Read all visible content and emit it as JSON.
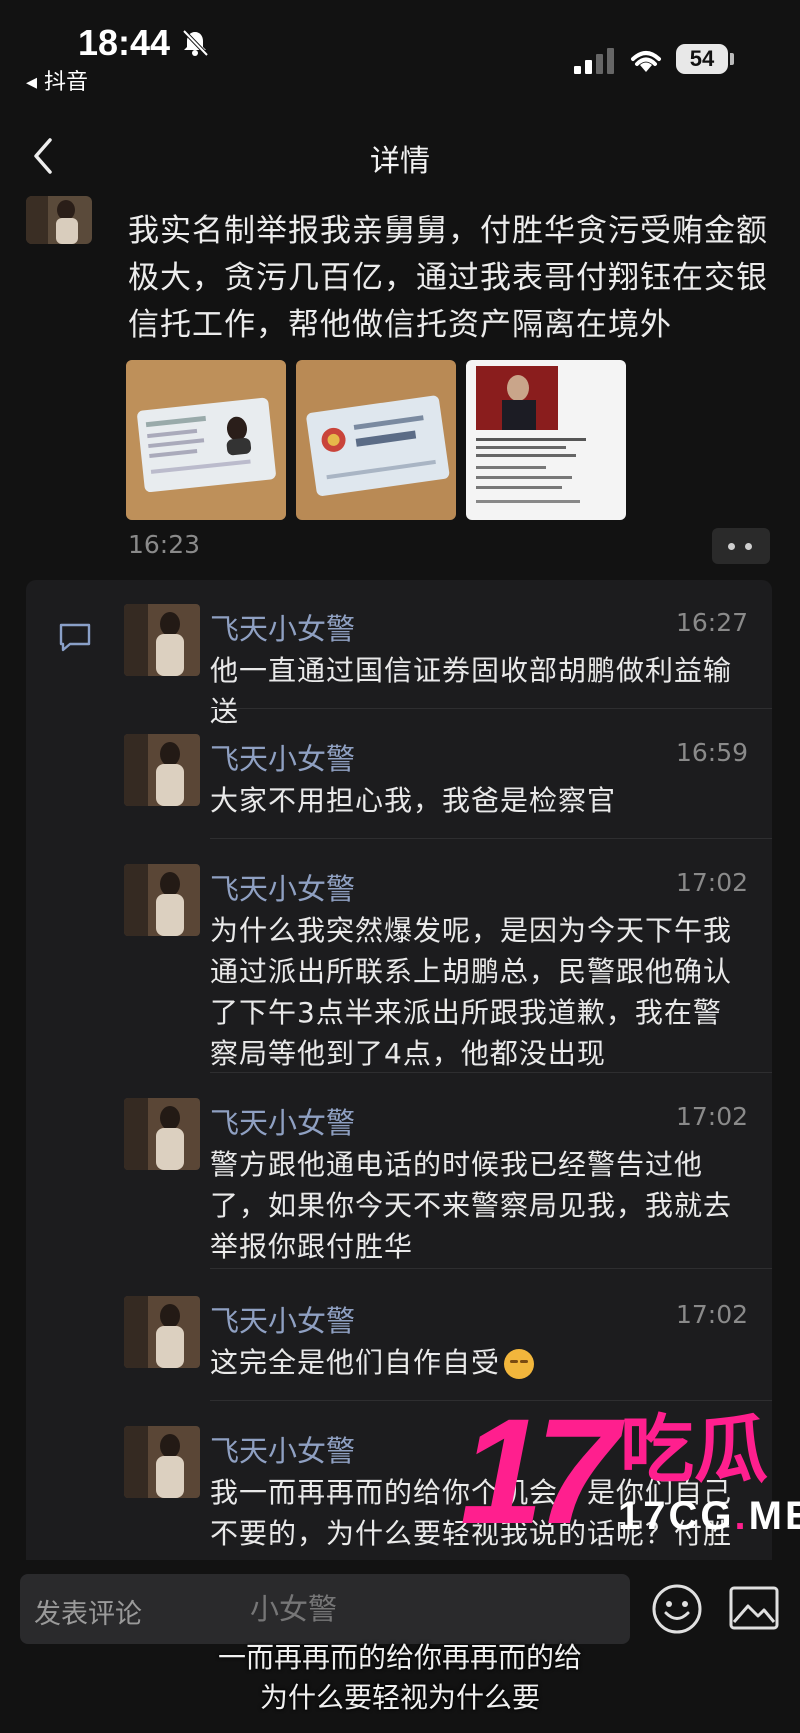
{
  "status_bar": {
    "time": "18:44",
    "back_app": "◂ 抖音",
    "battery": "54"
  },
  "nav": {
    "title": "详情"
  },
  "post": {
    "text": "我实名制举报我亲舅舅，付胜华贪污受贿金额极大，贪污几百亿，通过我表哥付翔钰在交银信托工作，帮他做信托资产隔离在境外",
    "time": "16:23"
  },
  "comments": [
    {
      "name": "飞天小女警",
      "time": "16:27",
      "text": "他一直通过国信证券固收部胡鹏做利益输送"
    },
    {
      "name": "飞天小女警",
      "time": "16:59",
      "text": "大家不用担心我，我爸是检察官"
    },
    {
      "name": "飞天小女警",
      "time": "17:02",
      "text": "为什么我突然爆发呢，是因为今天下午我通过派出所联系上胡鹏总，民警跟他确认了下午3点半来派出所跟我道歉，我在警察局等他到了4点，他都没出现"
    },
    {
      "name": "飞天小女警",
      "time": "17:02",
      "text": "警方跟他通电话的时候我已经警告过他了，如果你今天不来警察局见我，我就去举报你跟付胜华"
    },
    {
      "name": "飞天小女警",
      "time": "17:02",
      "text": "这完全是他们自作自受"
    },
    {
      "name": "飞天小女警",
      "time": "",
      "text": "我一而再再而的给你个机会，是你们自己不要的，为什么要轻视我说的话呢？付胜胡总"
    }
  ],
  "watermark": {
    "big": "17",
    "cn": "吃瓜",
    "domain_a": "17CG",
    "domain_b": ".",
    "domain_c": "ME"
  },
  "input": {
    "placeholder": "发表评论",
    "ghost_name": "小女警"
  },
  "subtitles": {
    "line1": "一而再再而的给你再再而的给",
    "line2": "为什么要轻视为什么要"
  }
}
